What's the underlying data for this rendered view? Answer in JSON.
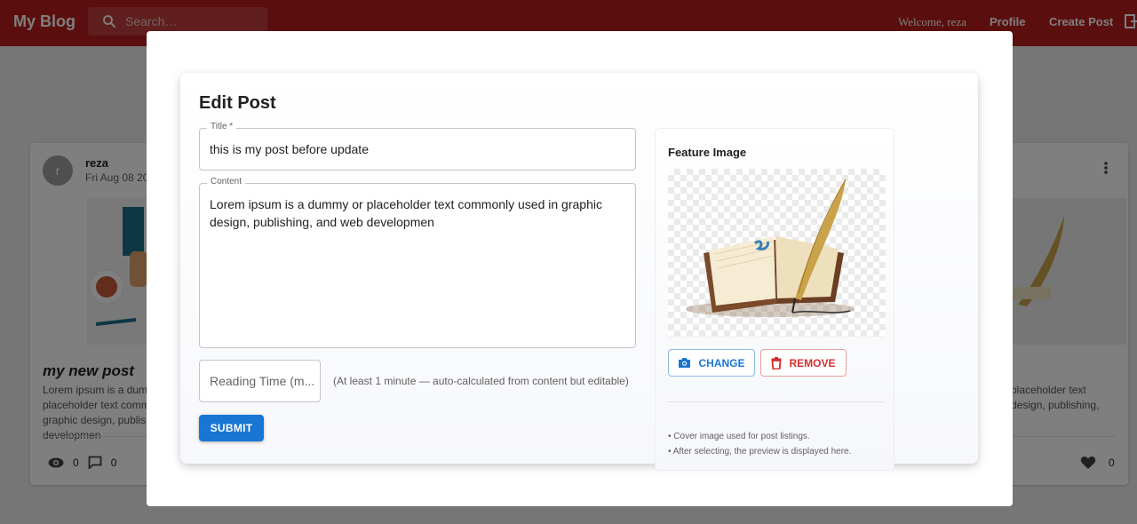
{
  "appbar": {
    "brand": "My Blog",
    "search_placeholder": "Search…",
    "welcome": "Welcome, reza",
    "profile": "Profile",
    "create_post": "Create Post"
  },
  "posts": [
    {
      "avatar_letter": "r",
      "author": "reza",
      "date": "Fri Aug 08 20",
      "title": "my new post",
      "excerpt": "Lorem ipsum is a dummy or placeholder text commonly used in graphic design, publishing, and web developmen",
      "views": "0",
      "comments": "0"
    },
    {
      "excerpt": "placeholder text design, publishing,",
      "likes": "0"
    }
  ],
  "edit_post": {
    "heading": "Edit Post",
    "title_label": "Title *",
    "title_value": "this is my post before update",
    "content_label": "Content",
    "content_value": "Lorem ipsum is a dummy or placeholder text commonly used in graphic design, publishing, and web developmen",
    "reading_placeholder": "Reading Time (m...",
    "reading_helper": "(At least 1 minute — auto-calculated from content but editable)",
    "submit": "SUBMIT"
  },
  "feature": {
    "heading": "Feature Image",
    "change": "CHANGE",
    "remove": "REMOVE",
    "notes": [
      "• Cover image used for post listings.",
      "• After selecting, the preview is displayed here."
    ]
  },
  "colors": {
    "appbar": "#b71c1c",
    "primary": "#1976d2",
    "error": "#d32f2f"
  }
}
